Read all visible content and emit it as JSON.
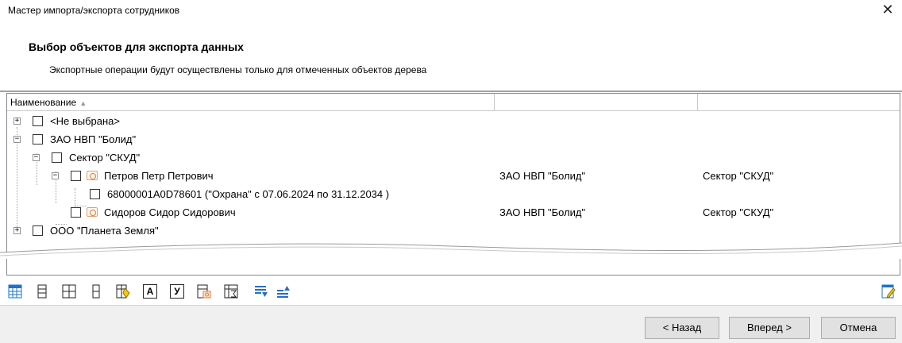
{
  "window": {
    "title": "Мастер импорта/экспорта сотрудников",
    "close_glyph": "✕"
  },
  "header": {
    "title": "Выбор объектов для экспорта данных",
    "subtitle": "Экспортные операции будут осуществлены только для отмеченных объектов дерева"
  },
  "grid": {
    "columns": [
      "Наименование",
      "",
      ""
    ],
    "sort_indicator": "▲",
    "rows": [
      {
        "label": "<Не выбрана>",
        "org": "",
        "dept": ""
      },
      {
        "label": "ЗАО НВП \"Болид\"",
        "org": "",
        "dept": ""
      },
      {
        "label": "Сектор \"СКУД\"",
        "org": "",
        "dept": ""
      },
      {
        "label": "Петров Петр Петрович",
        "org": "ЗАО НВП \"Болид\"",
        "dept": "Сектор \"СКУД\""
      },
      {
        "label": "68000001A0D78601 (\"Охрана\" с 07.06.2024  по 31.12.2034 )",
        "org": "",
        "dept": ""
      },
      {
        "label": "Сидоров Сидор Сидорович",
        "org": "ЗАО НВП \"Болид\"",
        "dept": "Сектор \"СКУД\""
      },
      {
        "label": "ООО \"Планета Земля\"",
        "org": "",
        "dept": ""
      }
    ]
  },
  "toolbar": {
    "icons": [
      "table-icon",
      "field-icon",
      "fields-icon",
      "column-icon",
      "fill-icon",
      "a-icon",
      "u-icon",
      "photo-icon",
      "sum-icon",
      "move-down-icon",
      "move-up-icon",
      "edit-icon"
    ],
    "a_label": "А",
    "u_label": "У"
  },
  "buttons": {
    "back": "< Назад",
    "next": "Вперед >",
    "cancel": "Отмена"
  },
  "colors": {
    "accent": "#1e73c8",
    "toolbar_blue": "#2a6ebb",
    "bg": "#f0f0f0"
  }
}
